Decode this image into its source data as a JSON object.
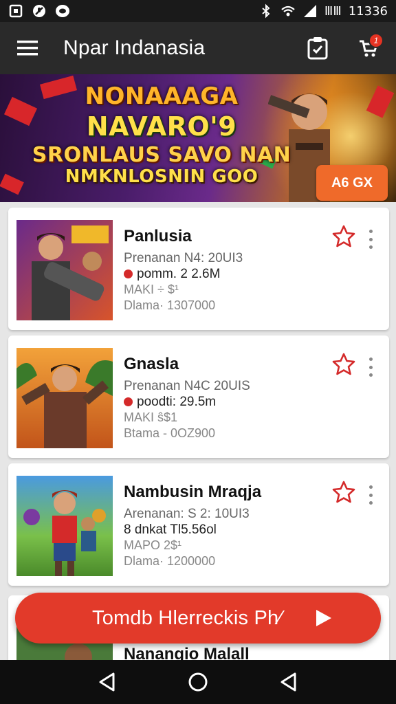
{
  "status_bar": {
    "left_icons": [
      "square-notification-icon",
      "no-mic-icon",
      "messenger-icon"
    ],
    "right_icons": [
      "bluetooth-icon",
      "wifi-icon",
      "signal-icon"
    ],
    "battery_text": "ⅢⅢ",
    "time": "11336"
  },
  "app_bar": {
    "title": "Npar Indanasia",
    "menu_icon": "hamburger-menu-icon",
    "clipboard_icon": "clipboard-icon",
    "cart_icon": "cart-icon",
    "cart_badge": "1"
  },
  "banner": {
    "line1": "NONAAAGA",
    "line2": "NAVARO'9",
    "line3": "SRONLAUS SAVO NAN",
    "line4": "NMKNLOSNIN GOO",
    "cta": "A6 GX"
  },
  "items": [
    {
      "title": "Panlusia",
      "line1": "Prenanan N4: 20UI3",
      "line2": "pomm. 2 2.6M",
      "line3": "MAKI ÷ $¹",
      "line4": "Dlama· 1307000"
    },
    {
      "title": "Gnasla",
      "line1": "Prenanan N4C 20UIS",
      "line2": "poodti: 29.5m",
      "line3": "MAKI ŝ$1",
      "line4": "Btama - 0OZ900"
    },
    {
      "title": "Nambusin Mraqja",
      "line1": "Arenanan: S 2: 10UI3",
      "line2": "8 dnkat Tl5.56ol",
      "line3": "MAPO 2$¹",
      "line4": "Dlama· 1200000"
    },
    {
      "title": "Nanangio Malall"
    }
  ],
  "fab": {
    "label": "Tomdb Hlerreckis Ph∕"
  },
  "nav_bar": {
    "back_icon": "back-triangle-icon",
    "home_icon": "home-circle-icon",
    "recents_icon": "recents-triangle-icon"
  },
  "colors": {
    "accent_red": "#e23a2a",
    "app_bar": "#2a2a2a",
    "banner_cta": "#ef6a2a"
  }
}
